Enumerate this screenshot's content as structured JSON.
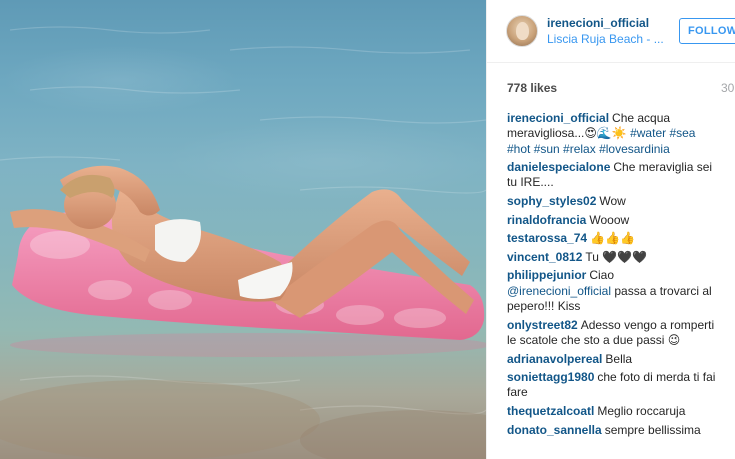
{
  "post": {
    "username": "irenecioni_official",
    "location": "Liscia Ruja Beach - ...",
    "follow_label": "FOLLOW",
    "likes": "778 likes",
    "age": "30"
  },
  "comments": [
    {
      "author": "irenecioni_official",
      "text": "Che acqua meravigliosa...😍🌊☀️ ",
      "tags": "#water #sea #hot #sun #relax #lovesardinia"
    },
    {
      "author": "danielespecialone",
      "text": "Che meraviglia sei tu IRE...."
    },
    {
      "author": "sophy_styles02",
      "text": "Wow"
    },
    {
      "author": "rinaldofrancia",
      "text": "Wooow"
    },
    {
      "author": "testarossa_74",
      "text": "👍👍👍"
    },
    {
      "author": "vincent_0812",
      "text": "Tu 🖤🖤🖤"
    },
    {
      "author": "philippejunior",
      "text": "Ciao ",
      "mention": "@irenecioni_official",
      "text2": " passa a trovarci al pepero!!! Kiss"
    },
    {
      "author": "onlystreet82",
      "text": "Adesso vengo a romperti le scatole che sto a due passi 😉"
    },
    {
      "author": "adrianavolpereal",
      "text": "Bella"
    },
    {
      "author": "soniettaɡg1980",
      "text": "che foto di merda ti fai fare"
    },
    {
      "author": "thequetzalcoatl",
      "text": "Meglio roccaruja"
    },
    {
      "author": "donato_sannella",
      "text": "sempre bellissima"
    }
  ],
  "colors": {
    "link": "#125688",
    "accent": "#3897f0",
    "muted": "#a5a7aa"
  },
  "icons": {
    "avatar": "profile-photo"
  }
}
